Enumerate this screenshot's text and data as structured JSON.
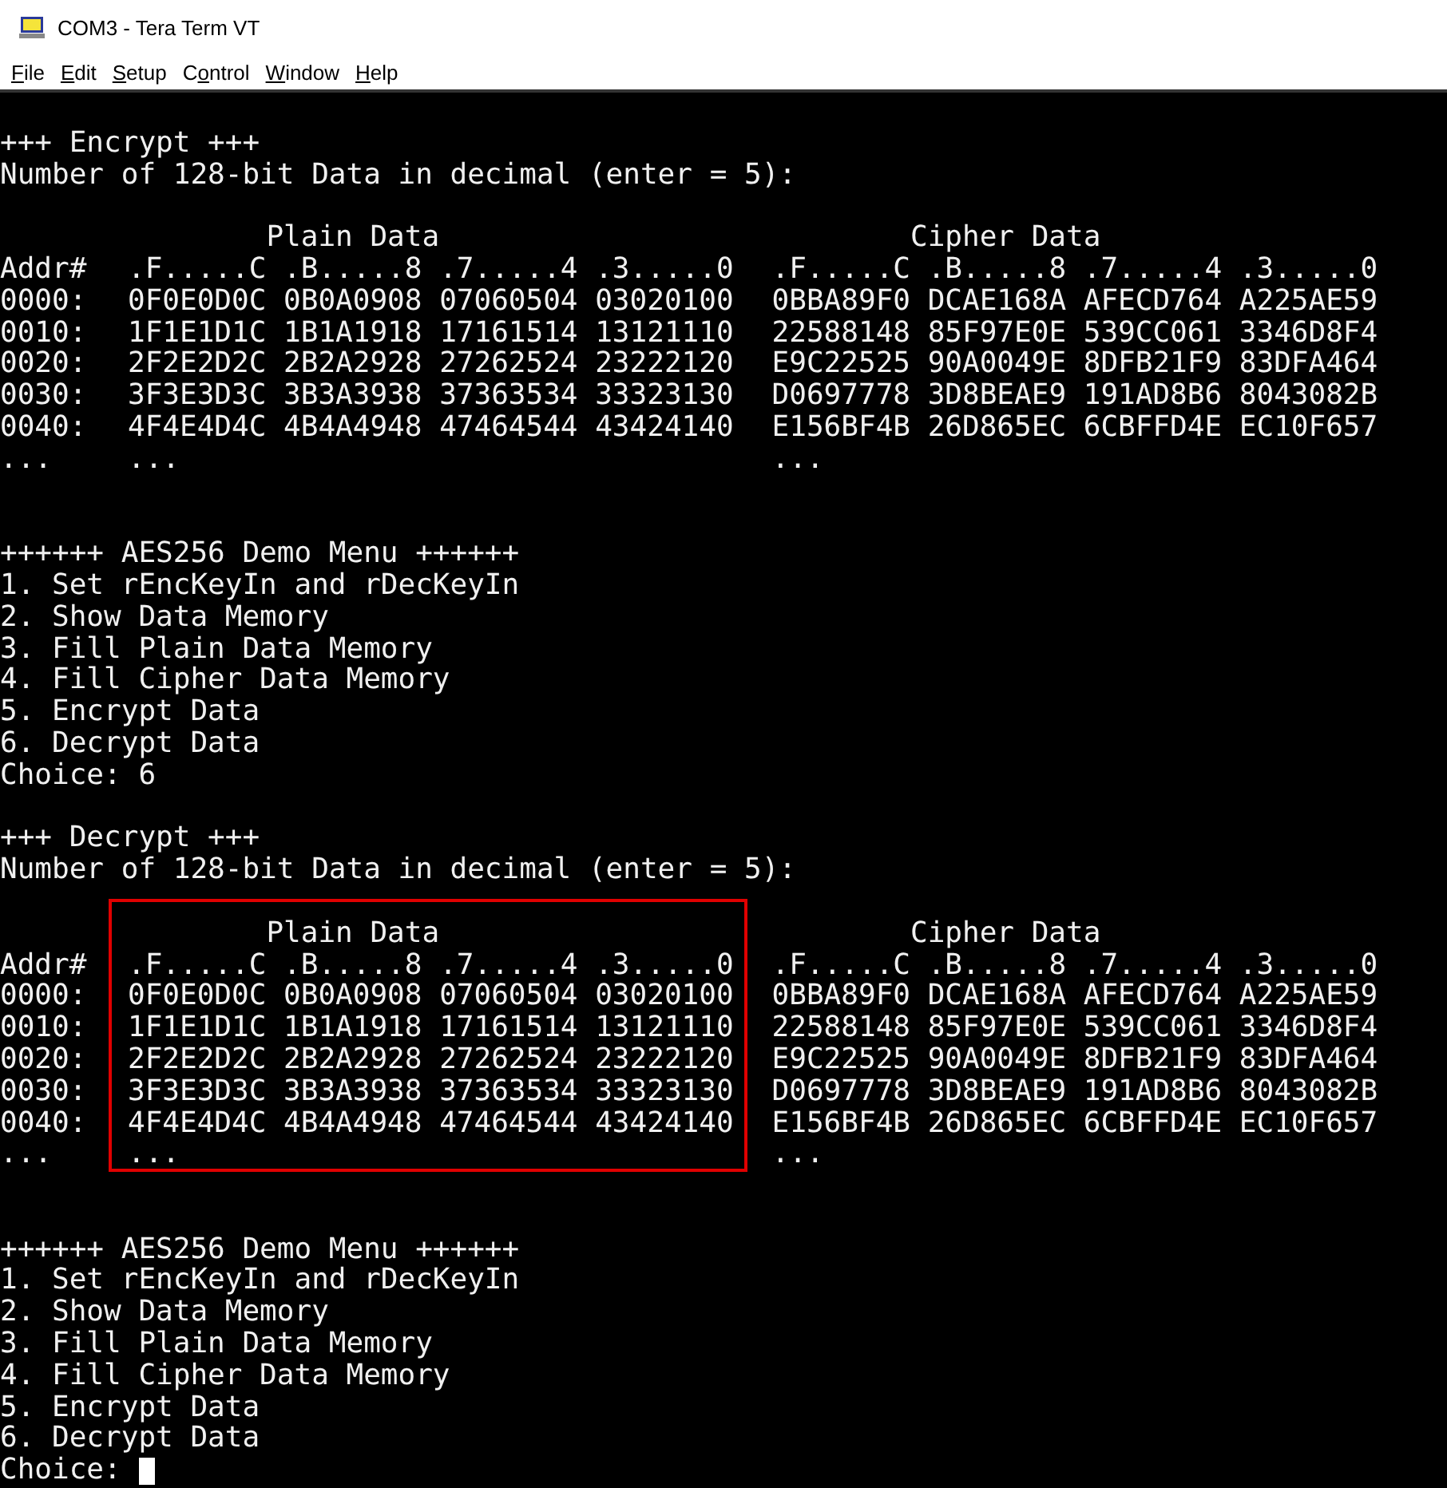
{
  "window": {
    "title": "COM3 - Tera Term VT"
  },
  "menu": [
    {
      "key": "F",
      "post": "ile"
    },
    {
      "key": "E",
      "post": "dit"
    },
    {
      "key": "S",
      "post": "etup"
    },
    {
      "pre": "C",
      "key": "o",
      "post": "ntrol"
    },
    {
      "key": "W",
      "post": "indow"
    },
    {
      "key": "H",
      "post": "elp"
    }
  ],
  "terminal": [
    {
      "kind": "blank"
    },
    {
      "kind": "text",
      "text": "+++ Encrypt +++"
    },
    {
      "kind": "text",
      "text": "Number of 128-bit Data in decimal (enter = 5):"
    },
    {
      "kind": "blank"
    },
    {
      "kind": "table",
      "addr_header": "Addr#",
      "addresses": [
        "0000:",
        "0010:",
        "0020:",
        "0030:",
        "0040:"
      ],
      "addr_more": "...",
      "plain": {
        "title": "Plain Data",
        "header": ".F.....C .B.....8 .7.....4 .3.....0",
        "rows": [
          "0F0E0D0C 0B0A0908 07060504 03020100",
          "1F1E1D1C 1B1A1918 17161514 13121110",
          "2F2E2D2C 2B2A2928 27262524 23222120",
          "3F3E3D3C 3B3A3938 37363534 33323130",
          "4F4E4D4C 4B4A4948 47464544 43424140"
        ],
        "more": "...",
        "highlighted": false
      },
      "cipher": {
        "title": "Cipher Data",
        "header": ".F.....C .B.....8 .7.....4 .3.....0",
        "rows": [
          "0BBA89F0 DCAE168A AFECD764 A225AE59",
          "22588148 85F97E0E 539CC061 3346D8F4",
          "E9C22525 90A0049E 8DFB21F9 83DFA464",
          "D0697778 3D8BEAE9 191AD8B6 8043082B",
          "E156BF4B 26D865EC 6CBFFD4E EC10F657"
        ],
        "more": "...",
        "highlighted": false
      }
    },
    {
      "kind": "blank"
    },
    {
      "kind": "blank"
    },
    {
      "kind": "text",
      "text": "++++++ AES256 Demo Menu ++++++"
    },
    {
      "kind": "text",
      "text": "1. Set rEncKeyIn and rDecKeyIn"
    },
    {
      "kind": "text",
      "text": "2. Show Data Memory"
    },
    {
      "kind": "text",
      "text": "3. Fill Plain Data Memory"
    },
    {
      "kind": "text",
      "text": "4. Fill Cipher Data Memory"
    },
    {
      "kind": "text",
      "text": "5. Encrypt Data"
    },
    {
      "kind": "text",
      "text": "6. Decrypt Data"
    },
    {
      "kind": "text",
      "text": "Choice: 6"
    },
    {
      "kind": "blank"
    },
    {
      "kind": "text",
      "text": "+++ Decrypt +++"
    },
    {
      "kind": "text",
      "text": "Number of 128-bit Data in decimal (enter = 5):"
    },
    {
      "kind": "blank"
    },
    {
      "kind": "table",
      "addr_header": "Addr#",
      "addresses": [
        "0000:",
        "0010:",
        "0020:",
        "0030:",
        "0040:"
      ],
      "addr_more": "...",
      "plain": {
        "title": "Plain Data",
        "header": ".F.....C .B.....8 .7.....4 .3.....0",
        "rows": [
          "0F0E0D0C 0B0A0908 07060504 03020100",
          "1F1E1D1C 1B1A1918 17161514 13121110",
          "2F2E2D2C 2B2A2928 27262524 23222120",
          "3F3E3D3C 3B3A3938 37363534 33323130",
          "4F4E4D4C 4B4A4948 47464544 43424140"
        ],
        "more": "...",
        "highlighted": true
      },
      "cipher": {
        "title": "Cipher Data",
        "header": ".F.....C .B.....8 .7.....4 .3.....0",
        "rows": [
          "0BBA89F0 DCAE168A AFECD764 A225AE59",
          "22588148 85F97E0E 539CC061 3346D8F4",
          "E9C22525 90A0049E 8DFB21F9 83DFA464",
          "D0697778 3D8BEAE9 191AD8B6 8043082B",
          "E156BF4B 26D865EC 6CBFFD4E EC10F657"
        ],
        "more": "...",
        "highlighted": false
      }
    },
    {
      "kind": "blank"
    },
    {
      "kind": "blank"
    },
    {
      "kind": "text",
      "text": "++++++ AES256 Demo Menu ++++++"
    },
    {
      "kind": "text",
      "text": "1. Set rEncKeyIn and rDecKeyIn"
    },
    {
      "kind": "text",
      "text": "2. Show Data Memory"
    },
    {
      "kind": "text",
      "text": "3. Fill Plain Data Memory"
    },
    {
      "kind": "text",
      "text": "4. Fill Cipher Data Memory"
    },
    {
      "kind": "text",
      "text": "5. Encrypt Data"
    },
    {
      "kind": "text",
      "text": "6. Decrypt Data"
    },
    {
      "kind": "prompt",
      "text": "Choice:",
      "cursor": true
    }
  ]
}
